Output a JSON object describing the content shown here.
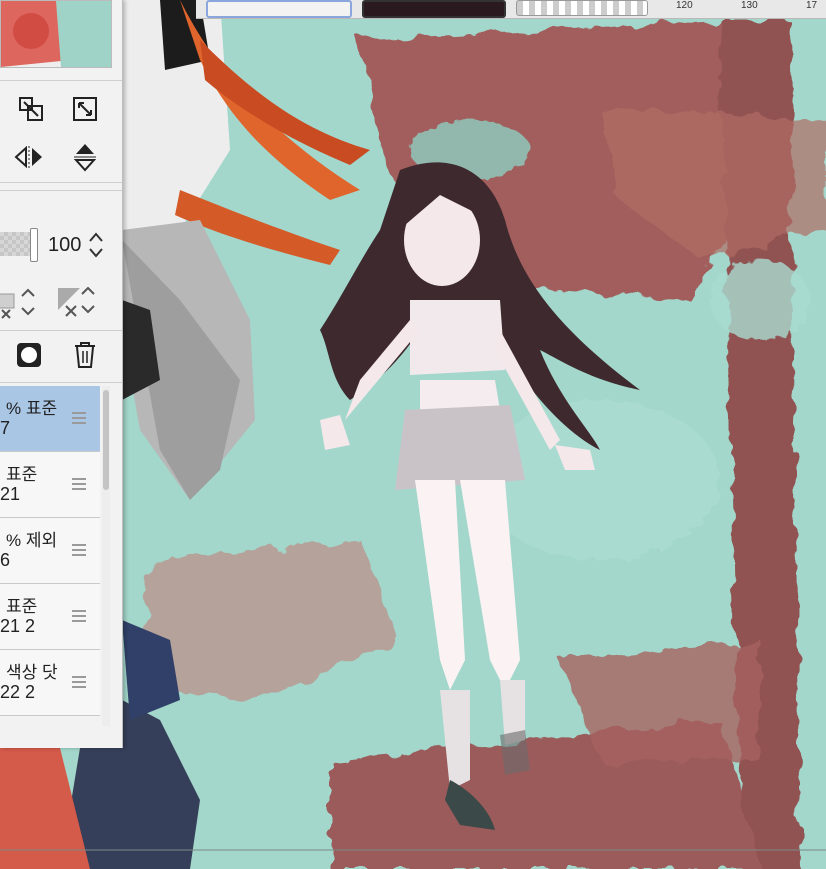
{
  "top_toolbar": {
    "numbers": [
      "120",
      "130",
      "17"
    ]
  },
  "layer_panel": {
    "opacity_value": "100",
    "layers": [
      {
        "mode": "% 표준",
        "num": "7",
        "selected": true
      },
      {
        "mode": "표준",
        "num": "21",
        "selected": false
      },
      {
        "mode": "% 제외",
        "num": "6",
        "selected": false
      },
      {
        "mode": "표준",
        "num": "21 2",
        "selected": false
      },
      {
        "mode": "색상 닷",
        "num": "22 2",
        "selected": false
      }
    ],
    "icons": {
      "transform_a": "scale-icon",
      "transform_b": "fit-icon",
      "flip_h": "flip-horizontal-icon",
      "flip_v": "flip-vertical-icon",
      "mask": "layer-mask-icon",
      "delete": "trash-icon"
    }
  },
  "colors": {
    "canvas_bg": "#9fd3c7",
    "selected_layer": "#a9c6e5",
    "panel_bg": "#f2f2f2",
    "grunge_red": "#a0403f",
    "hair": "#3e2a2e"
  }
}
